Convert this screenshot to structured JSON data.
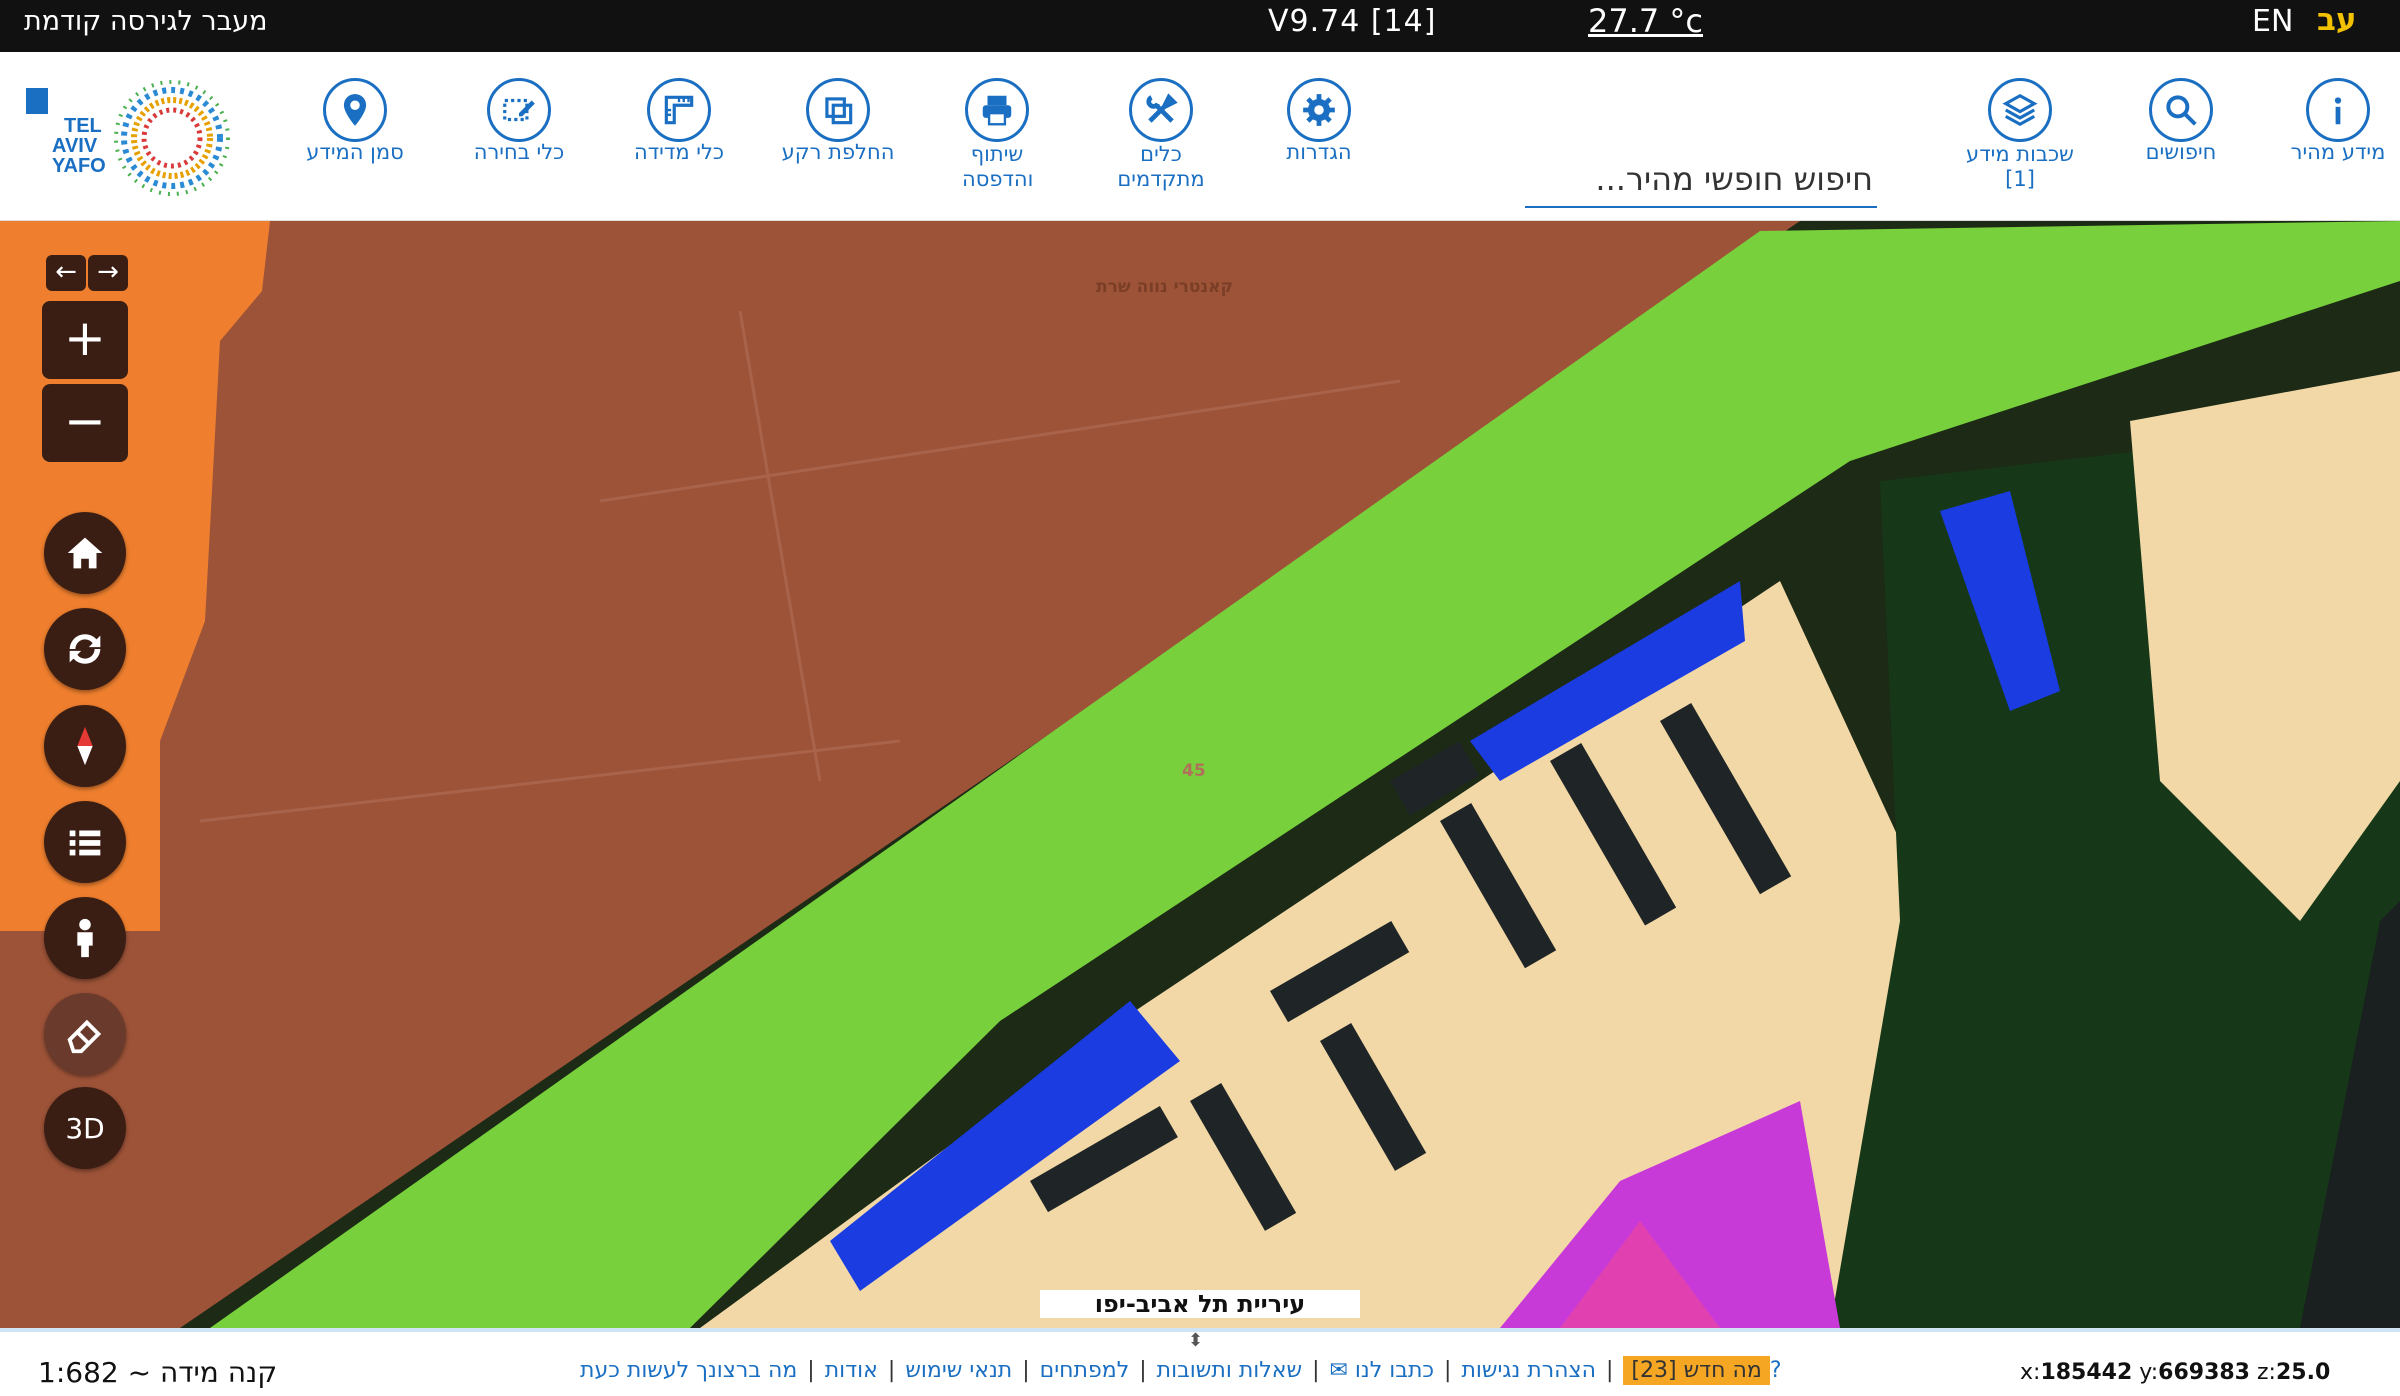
{
  "topbar": {
    "prev_version": "מעבר לגירסה קודמת",
    "version": "V9.74 [14]",
    "temperature": "27.7 °c",
    "lang_en": "EN",
    "lang_he": "עב"
  },
  "toolbar": {
    "logo_text": "TEL AVIV YAFO",
    "tools": {
      "quick_info": "מידע מהיר",
      "searches": "חיפושים",
      "layers": "שכבות מידע [1]",
      "settings": "הגדרות",
      "advanced_tools": "כלים מתקדמים",
      "share_print": "שיתוף והדפסה",
      "switch_bg": "החלפת רקע",
      "measure": "כלי מדידה",
      "select": "כלי בחירה",
      "info_marker": "סמן המידע"
    },
    "search_placeholder": "חיפוש חופשי מהיר..."
  },
  "map": {
    "label_top": "קאנטרי נווה שרת",
    "label_number": "45",
    "credit": "עיריית תל אביב-יפו",
    "controls": {
      "back": "←",
      "forward": "→",
      "zoom_in": "+",
      "zoom_out": "−",
      "three_d": "3D"
    }
  },
  "bottombar": {
    "scale_label": "קנה מידה ~ 1:682",
    "links": {
      "what_to_do": "מה ברצונך לעשות כעת?",
      "about": "אודות",
      "terms": "תנאי שימוש",
      "developers": "למפתחים",
      "faq": "שאלות ותשובות",
      "contact": "כתבו לנו ✉",
      "accessibility": "הצהרת נגישות",
      "whats_new": "מה חדש [23]"
    },
    "coords": {
      "x_label": "x:",
      "x": "185442",
      "y_label": "y:",
      "y": "669383",
      "z_label": "z:",
      "z": "25.0"
    }
  }
}
